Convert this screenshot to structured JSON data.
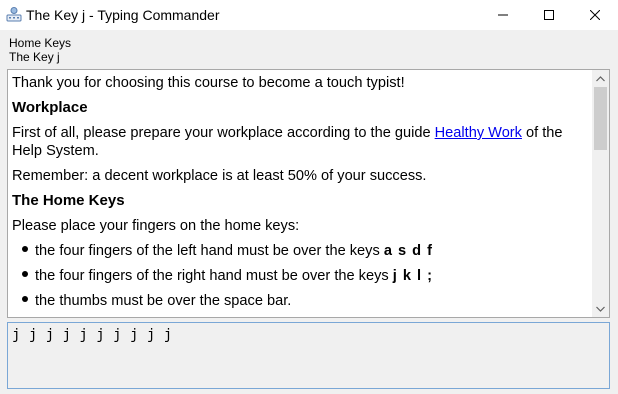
{
  "window": {
    "title": "The Key j - Typing Commander",
    "icons": {
      "app": "typing-commander-icon",
      "minimize": "minimize-icon",
      "maximize": "maximize-icon",
      "close": "close-icon"
    }
  },
  "breadcrumb": {
    "course": "Home Keys",
    "lesson": "The Key j"
  },
  "lesson": {
    "intro": "Thank you for choosing this course to become a touch typist!",
    "heading_workplace": "Workplace",
    "workplace_text_before": "First of all, please prepare your workplace according to the guide ",
    "workplace_link": "Healthy Work",
    "workplace_text_after": " of the",
    "workplace_text_line2": "Help System.",
    "remember": "Remember: a decent workplace is at least 50% of your success.",
    "heading_home_keys": "The Home Keys",
    "home_keys_text": "Please place your fingers on the home keys:",
    "bullets": [
      {
        "text": "the four fingers of the left hand must be over the keys ",
        "keys": "a s d f"
      },
      {
        "text": "the four fingers of the right hand must be over the keys ",
        "keys": "j k l ;"
      },
      {
        "text": "the thumbs must be over the space bar.",
        "keys": ""
      }
    ]
  },
  "typing": {
    "value": "j j j j j j j j j j"
  }
}
